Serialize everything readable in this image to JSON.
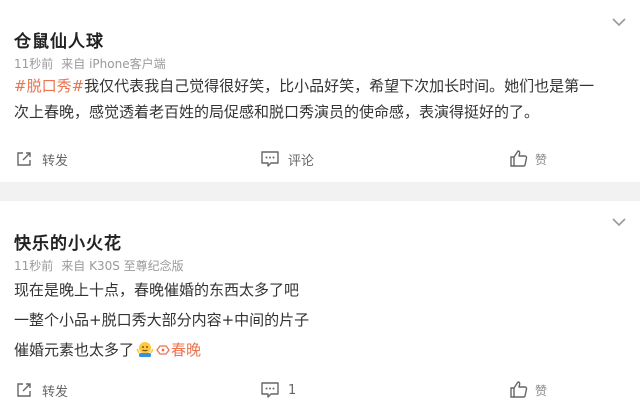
{
  "posts": [
    {
      "username": "仓鼠仙人球",
      "time": "11秒前",
      "source": "来自 iPhone客户端",
      "hashtag": "#脱口秀#",
      "text_lines": [
        "我仅代表我自己觉得很好笑，比小品好笑，希望下次加长时间。她们也是第一",
        "次上春晚，感觉透着老百姓的局促感和脱口秀演员的使命感，表演得挺好的了。"
      ],
      "actions": {
        "share": "转发",
        "comment": "评论",
        "like": "赞"
      }
    },
    {
      "username": "快乐的小火花",
      "time": "11秒前",
      "source": "来自 K30S 至尊纪念版",
      "text_lines": [
        "现在是晚上十点，春晚催婚的东西太多了吧",
        "一整个小品+脱口秀大部分内容+中间的片子",
        "催婚元素也太多了"
      ],
      "topic": "春晚",
      "emoji_icon": "shrug-emoji-icon",
      "actions": {
        "share": "转发",
        "comment": "1",
        "like": "赞"
      }
    }
  ],
  "colors": {
    "accent": "#eb7350",
    "meta": "#9a9a9a",
    "background": "#f2f2f2"
  }
}
